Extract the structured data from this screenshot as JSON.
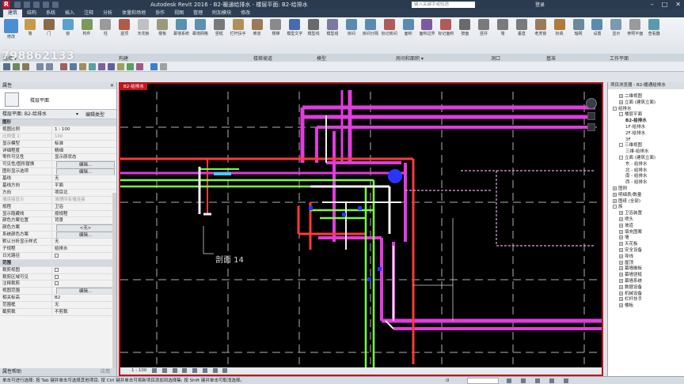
{
  "window": {
    "title": "Autodesk Revit 2016 -    B2-暖通给排水 - 楼层平面: B2-给排水",
    "search_placeholder": "键入关键字或短语",
    "login": "登录",
    "app_letter": "R"
  },
  "ribbon": {
    "tabs": [
      "建筑",
      "结构",
      "系统",
      "插入",
      "注释",
      "分析",
      "体量和场地",
      "协作",
      "视图",
      "管理",
      "附加模块",
      "修改"
    ],
    "tools": [
      "修改",
      "墙",
      "门",
      "窗",
      "构件",
      "柱",
      "屋顶",
      "天花板",
      "楼板",
      "幕墙系统",
      "幕墙网格",
      "竖梃",
      "栏杆扶手",
      "坡道",
      "楼梯",
      "模型文字",
      "模型线",
      "模型组",
      "房间",
      "房间分隔",
      "标记房间",
      "面积",
      "面积边界",
      "标记面积",
      "按面",
      "竖井",
      "墙",
      "垂直",
      "老虎窗",
      "标高",
      "轴网",
      "设置",
      "显示",
      "参照平面",
      "查看器"
    ],
    "panels": [
      "选择 ▾",
      "构建",
      "楼梯坡道",
      "模型",
      "房间和面积 ▾",
      "洞口",
      "基准",
      "工作平面"
    ]
  },
  "watermark": "798862133",
  "properties": {
    "header": "属性",
    "type_name": "楼层平面",
    "instance_label": "楼层平面: B2-给排水",
    "edit_type": "编辑类型",
    "rows": [
      {
        "n": "图形",
        "v": "",
        "group": true
      },
      {
        "n": "视图比例",
        "v": "1 : 100"
      },
      {
        "n": "比例值 1:",
        "v": "100",
        "grey": true
      },
      {
        "n": "显示模型",
        "v": "标准"
      },
      {
        "n": "详细程度",
        "v": "精细"
      },
      {
        "n": "零件可见性",
        "v": "显示原状态"
      },
      {
        "n": "可见性/图形替换",
        "v": "编辑...",
        "btn": true
      },
      {
        "n": "图形显示选项",
        "v": "编辑...",
        "btn": true
      },
      {
        "n": "基线",
        "v": "无"
      },
      {
        "n": "基线方向",
        "v": "平面"
      },
      {
        "n": "方向",
        "v": "项目北"
      },
      {
        "n": "墙连接显示",
        "v": "清理所有墙连接",
        "grey": true
      },
      {
        "n": "规程",
        "v": "卫浴"
      },
      {
        "n": "显示隐藏线",
        "v": "按规程"
      },
      {
        "n": "颜色方案位置",
        "v": "背景"
      },
      {
        "n": "颜色方案",
        "v": "<无>",
        "btn": true
      },
      {
        "n": "系统颜色方案",
        "v": "编辑...",
        "btn": true
      },
      {
        "n": "默认分析显示样式",
        "v": "无"
      },
      {
        "n": "子规程",
        "v": "给排水"
      },
      {
        "n": "日光路径",
        "v": "",
        "chk": true
      },
      {
        "n": "范围",
        "v": "",
        "group": true
      },
      {
        "n": "裁剪视图",
        "v": "",
        "chk": true
      },
      {
        "n": "裁剪区域可见",
        "v": "",
        "chk": true
      },
      {
        "n": "注释裁剪",
        "v": "",
        "chk": true
      },
      {
        "n": "视图范围",
        "v": "编辑...",
        "btn": true
      },
      {
        "n": "相关标高",
        "v": "B2"
      },
      {
        "n": "范围框",
        "v": "无"
      },
      {
        "n": "截剪裁",
        "v": "不剪裁"
      }
    ],
    "help": "属性帮助",
    "apply": "应用"
  },
  "view": {
    "tab_label": "B2-给排水",
    "scale": "1 : 100",
    "section_label": "剖面 14"
  },
  "browser": {
    "header": "项目浏览器 - B2-暖通给排水",
    "nodes": [
      {
        "t": "二维视图",
        "d": 1,
        "e": "+"
      },
      {
        "t": "立面 (建筑立面)",
        "d": 1,
        "e": "+"
      },
      {
        "t": "给排水",
        "d": 0,
        "e": "-"
      },
      {
        "t": "楼层平面",
        "d": 1,
        "e": "-"
      },
      {
        "t": "B2-给排水",
        "d": 2,
        "bold": true
      },
      {
        "t": "1F-给排水",
        "d": 2
      },
      {
        "t": "2F-给排水",
        "d": 2
      },
      {
        "t": "3F",
        "d": 2
      },
      {
        "t": "三维视图",
        "d": 1,
        "e": "-"
      },
      {
        "t": "三维-给排水",
        "d": 2
      },
      {
        "t": "立面 (建筑立面)",
        "d": 1,
        "e": "-"
      },
      {
        "t": "东 - 给排水",
        "d": 2
      },
      {
        "t": "北 - 给排水",
        "d": 2
      },
      {
        "t": "南 - 给排水",
        "d": 2
      },
      {
        "t": "西 - 给排水",
        "d": 2
      },
      {
        "t": "图例",
        "d": 0,
        "e": "+"
      },
      {
        "t": "明细表/数量",
        "d": 0,
        "e": "+"
      },
      {
        "t": "图纸 (全部)",
        "d": 0,
        "e": "+"
      },
      {
        "t": "族",
        "d": 0,
        "e": "-"
      },
      {
        "t": "卫浴装置",
        "d": 1,
        "e": "+"
      },
      {
        "t": "喷头",
        "d": 1,
        "e": "+"
      },
      {
        "t": "坡道",
        "d": 1,
        "e": "+"
      },
      {
        "t": "填充图案",
        "d": 1,
        "e": "+"
      },
      {
        "t": "墙",
        "d": 1,
        "e": "+"
      },
      {
        "t": "天花板",
        "d": 1,
        "e": "+"
      },
      {
        "t": "安全设备",
        "d": 1,
        "e": "+"
      },
      {
        "t": "导线",
        "d": 1,
        "e": "+"
      },
      {
        "t": "屋顶",
        "d": 1,
        "e": "+"
      },
      {
        "t": "幕墙嵌板",
        "d": 1,
        "e": "+"
      },
      {
        "t": "幕墙竖梃",
        "d": 1,
        "e": "+"
      },
      {
        "t": "幕墙系统",
        "d": 1,
        "e": "+"
      },
      {
        "t": "数据设备",
        "d": 1,
        "e": "+"
      },
      {
        "t": "机械设备",
        "d": 1,
        "e": "+"
      },
      {
        "t": "栏杆扶手",
        "d": 1,
        "e": "+"
      },
      {
        "t": "楼板",
        "d": 1,
        "e": "+"
      }
    ]
  },
  "statusbar": {
    "text": "单击可进行选择; 按 Tab 键并单击可选择其他项目; 按 Ctrl 键并单击可将新项目添加到选择集; 按 Shift 键并单击可取消选择。",
    "zero": ":0"
  },
  "colors": {
    "pipe_magenta": "#e23be0",
    "pipe_green": "#7bff3a",
    "pipe_red": "#ff3a3a",
    "pipe_white": "#f0f0f0",
    "accent": "#c0161e"
  }
}
